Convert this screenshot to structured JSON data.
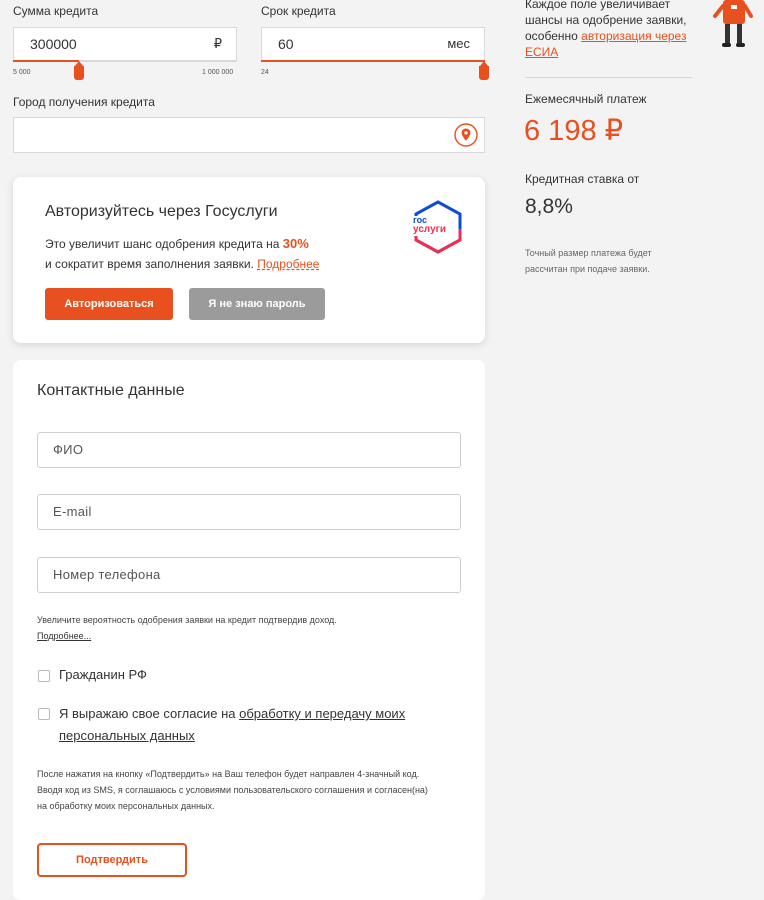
{
  "calculator": {
    "amount": {
      "label": "Сумма кредита",
      "value": "300000",
      "unit": "₽",
      "min": "5 000",
      "max": "1 000 000"
    },
    "term": {
      "label": "Срок кредита",
      "value": "60",
      "unit": "мес",
      "min": "24"
    },
    "city": {
      "label": "Город получения кредита",
      "value": ""
    }
  },
  "gosuslugi": {
    "title": "Авторизуйтесь через Госуслуги",
    "text_1": "Это увеличит шанс одобрения кредита на ",
    "percent": "30%",
    "text_2": "и сократит время заполнения заявки. ",
    "more": "Подробнее",
    "auth_button": "Авторизоваться",
    "forgot_button": "Я не знаю пароль",
    "logo_line1": "гос",
    "logo_line2": "услуги"
  },
  "contacts": {
    "title": "Контактные данные",
    "fio_placeholder": "ФИО",
    "email_placeholder": "E-mail",
    "phone_placeholder": "Номер телефона",
    "income_note": "Увеличите вероятность одобрения заявки на кредит подтвердив доход.",
    "income_more": "Подробнее...",
    "citizen_label": "Гражданин РФ",
    "consent_prefix": "Я выражаю свое согласие на ",
    "consent_link": "обработку и передачу моих персональных данных",
    "sms_note": "После нажатия на кнопку «Подтвердить» на Ваш телефон будет направлен 4-значный код. Вводя код из SMS, я соглашаюсь с условиями пользовательского соглашения и согласен(на) на обработку моих персональных данных.",
    "submit_button": "Подтвердить"
  },
  "sidebar": {
    "hint_1": "Каждое поле увеличивает шансы на одобрение заявки, особенно ",
    "hint_link": "авторизация через ЕСИА",
    "monthly_label": "Ежемесячный платеж",
    "monthly_value": "6 198 ₽",
    "rate_label": "Кредитная ставка от",
    "rate_value": "8,8%",
    "note": "Точный размер платежа будет рассчитан при подаче заявки."
  },
  "colors": {
    "accent": "#e8501f",
    "grey_button": "#9b9b9b",
    "background": "#f3f3f3"
  },
  "icons": [
    "map-pin-icon",
    "gosuslugi-logo",
    "mascot-figure"
  ]
}
